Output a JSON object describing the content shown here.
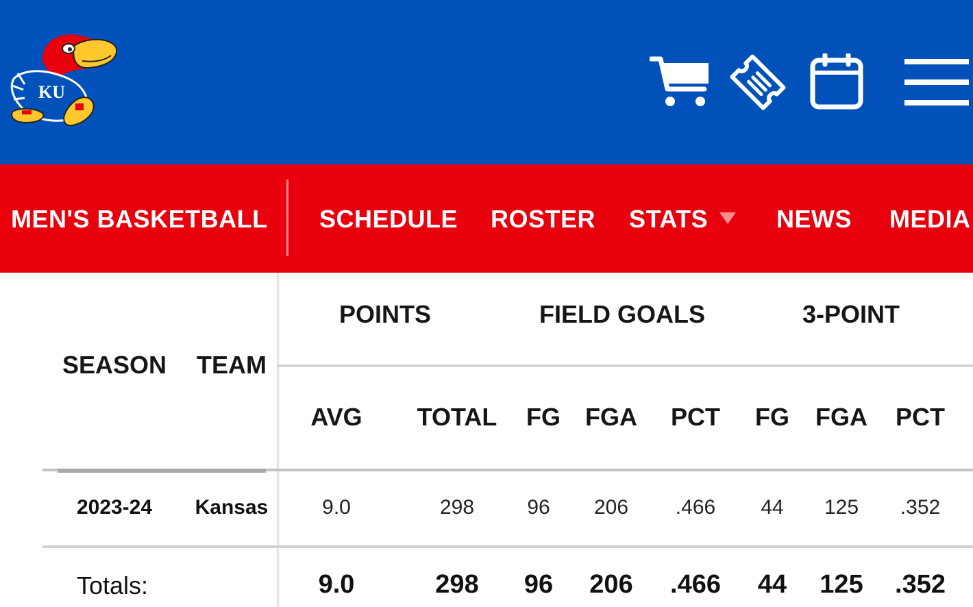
{
  "brand": {
    "logo_name": "kansas-jayhawk-logo",
    "logo_text": "KU",
    "colors": {
      "blue": "#0051ba",
      "red": "#e8000d",
      "yellow": "#ffc82d"
    }
  },
  "header_icons": [
    "shopping-cart-icon",
    "ticket-icon",
    "calendar-icon",
    "hamburger-menu-icon"
  ],
  "nav": {
    "sport": "MEN'S BASKETBALL",
    "items": [
      "SCHEDULE",
      "ROSTER",
      "STATS",
      "NEWS",
      "MEDIA"
    ]
  },
  "table": {
    "frozen_headers": {
      "season": "SEASON",
      "team": "TEAM"
    },
    "groups": {
      "points": "POINTS",
      "field_goals": "FIELD GOALS",
      "three_point": "3-POINT"
    },
    "columns": [
      "AVG",
      "TOTAL",
      "FG",
      "FGA",
      "PCT",
      "FG",
      "FGA",
      "PCT"
    ],
    "rows": [
      {
        "season": "2023-24",
        "team": "Kansas",
        "values": [
          "9.0",
          "298",
          "96",
          "206",
          ".466",
          "44",
          "125",
          ".352"
        ]
      }
    ],
    "totals": {
      "label": "Totals:",
      "values": [
        "9.0",
        "298",
        "96",
        "206",
        ".466",
        "44",
        "125",
        ".352"
      ]
    }
  }
}
